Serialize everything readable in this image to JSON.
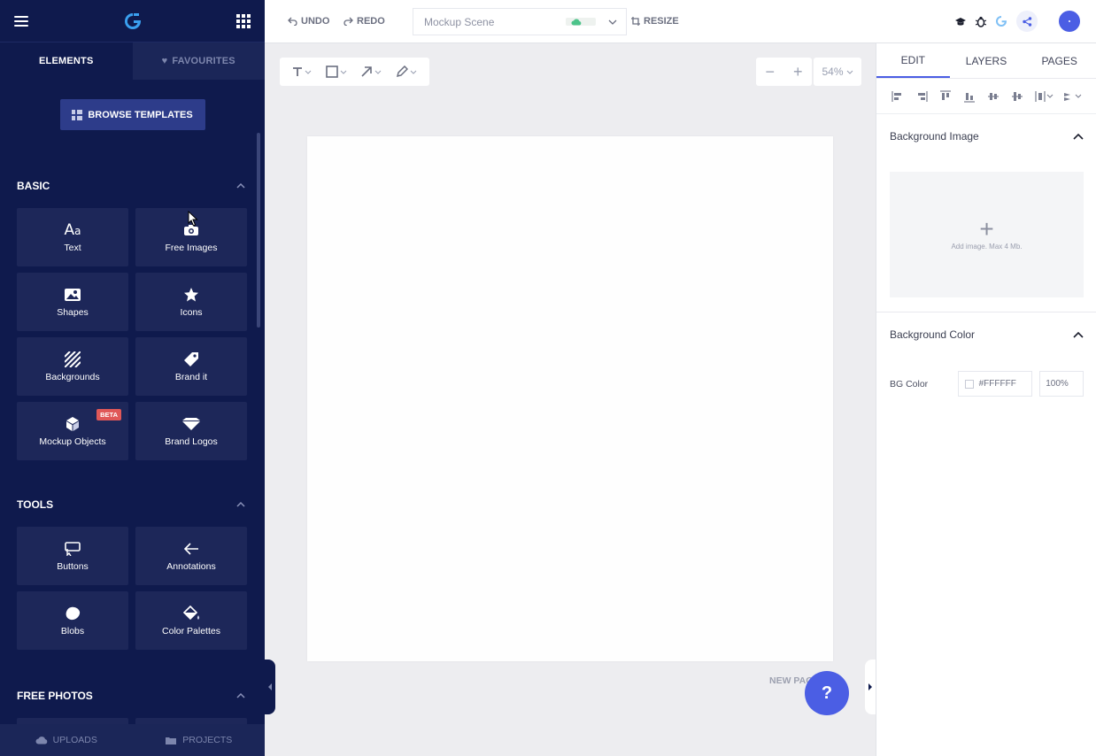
{
  "sidebar": {
    "tabs": [
      {
        "label": "ELEMENTS"
      },
      {
        "label": "FAVOURITES"
      }
    ],
    "browse_label": "BROWSE TEMPLATES",
    "sections": {
      "basic": {
        "title": "BASIC",
        "items": [
          {
            "label": "Text"
          },
          {
            "label": "Free Images"
          },
          {
            "label": "Shapes"
          },
          {
            "label": "Icons"
          },
          {
            "label": "Backgrounds"
          },
          {
            "label": "Brand it"
          },
          {
            "label": "Mockup Objects",
            "badge": "BETA"
          },
          {
            "label": "Brand Logos"
          }
        ]
      },
      "tools": {
        "title": "TOOLS",
        "items": [
          {
            "label": "Buttons"
          },
          {
            "label": "Annotations"
          },
          {
            "label": "Blobs"
          },
          {
            "label": "Color Palettes"
          }
        ]
      },
      "free_photos": {
        "title": "FREE PHOTOS"
      }
    },
    "bottom": [
      {
        "label": "UPLOADS"
      },
      {
        "label": "PROJECTS"
      }
    ]
  },
  "topbar": {
    "undo_label": "UNDO",
    "redo_label": "REDO",
    "scene_name": "Mockup Scene",
    "resize_label": "RESIZE"
  },
  "canvas": {
    "zoom": "54%",
    "new_page_label": "NEW PAGE",
    "background": "#FEFEFE"
  },
  "help": {
    "label": "?"
  },
  "right_panel": {
    "tabs": [
      {
        "label": "EDIT"
      },
      {
        "label": "LAYERS"
      },
      {
        "label": "PAGES"
      }
    ],
    "bg_image": {
      "title": "Background Image",
      "dropzone_text": "Add image. Max 4 Mb."
    },
    "bg_color": {
      "title": "Background Color",
      "label": "BG Color",
      "value": "#FFFFFF",
      "opacity": "100%"
    }
  },
  "colors": {
    "sidebar": "#0f1a4d",
    "accent": "#4b5ee4"
  }
}
